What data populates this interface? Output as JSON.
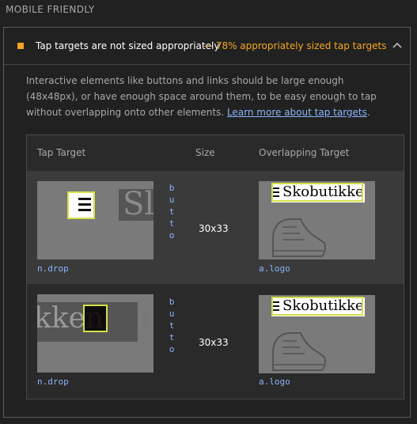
{
  "section": {
    "title": "MOBILE FRIENDLY"
  },
  "audit": {
    "title": "Tap targets are not sized appropriately",
    "display_value": "— 78% appropriately sized tap targets",
    "description_prefix": "Interactive elements like buttons and links should be large enough (48x48px), or have enough space around them, to be easy enough to tap without overlapping onto other elements.",
    "learn_more_link": "Learn more about tap targets",
    "description_suffix": "."
  },
  "table": {
    "headers": [
      "Tap Target",
      "Size",
      "Overlapping Target"
    ],
    "rows": [
      {
        "tap_target_node": "n.drop",
        "tap_target_snippet": "butto",
        "size": "30x33",
        "overlap_node": "a.logo",
        "tap_thumb_text": "Sl",
        "overlap_thumb_text": "Skobutikke"
      },
      {
        "tap_target_node": "n.drop",
        "tap_target_snippet": "butto",
        "size": "30x33",
        "overlap_node": "a.logo",
        "tap_thumb_text": "kken",
        "overlap_thumb_text": "Skobutikke"
      }
    ]
  },
  "colors": {
    "warning": "#f5a524",
    "link": "#8ab4f8",
    "highlight": "#d6e04a"
  }
}
